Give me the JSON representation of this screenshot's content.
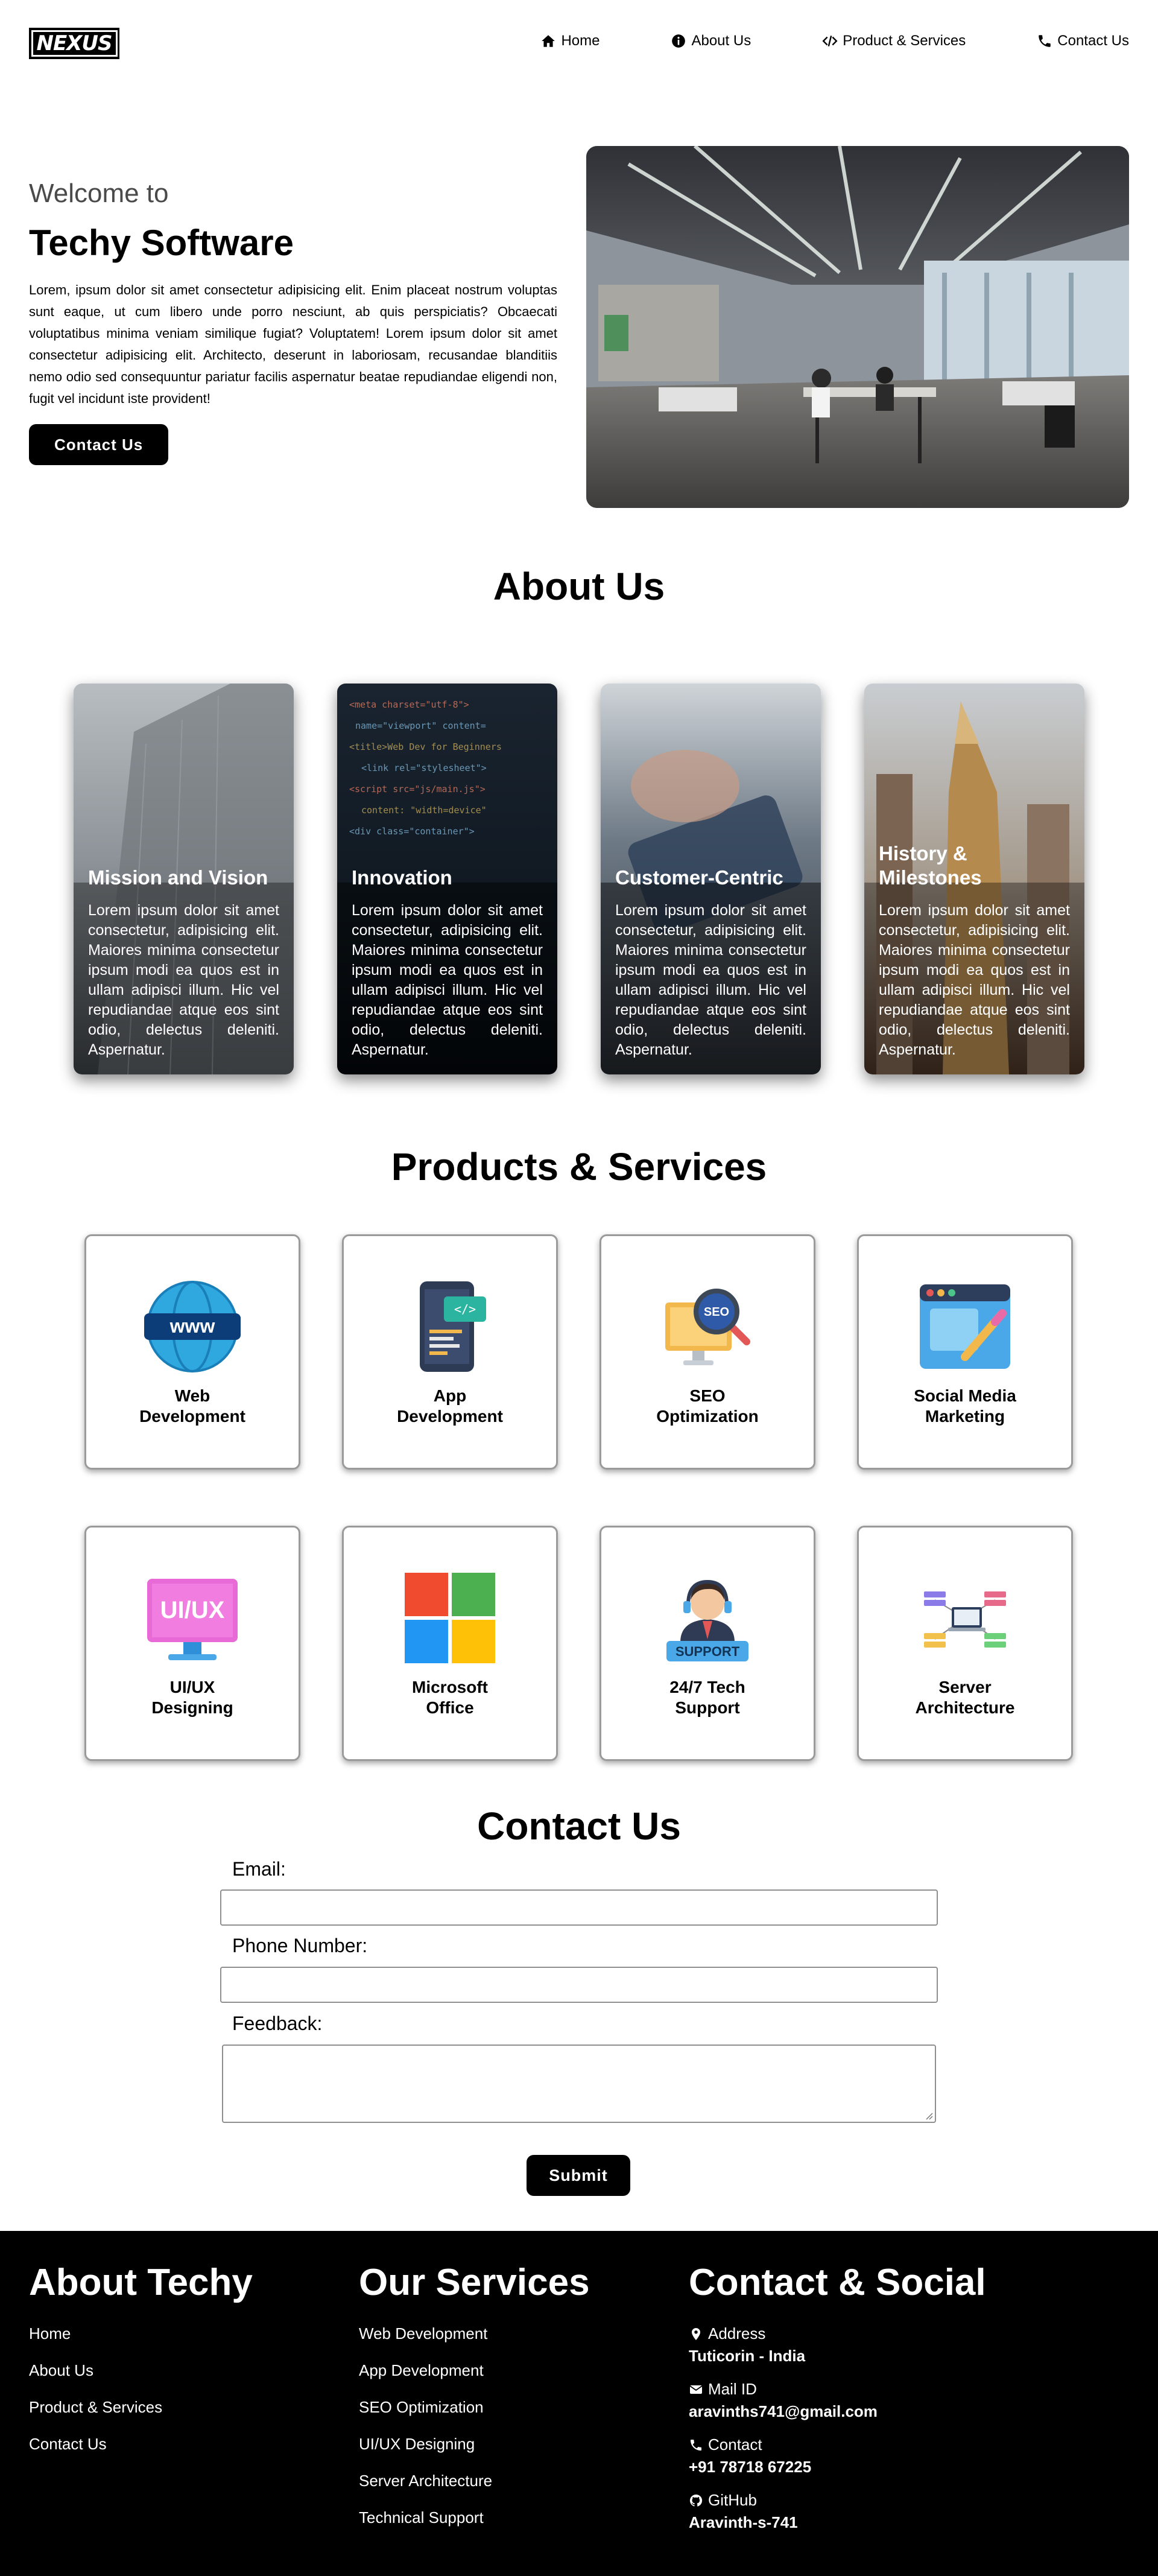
{
  "nav": {
    "logo": "NEXUS",
    "links": [
      {
        "label": "Home",
        "icon": "home-icon"
      },
      {
        "label": "About Us",
        "icon": "info-icon"
      },
      {
        "label": "Product & Services",
        "icon": "code-icon"
      },
      {
        "label": "Contact Us",
        "icon": "phone-icon"
      }
    ]
  },
  "hero": {
    "welcome": "Welcome to",
    "title": "Techy Software",
    "text": "Lorem, ipsum dolor sit amet consectetur adipisicing elit. Enim placeat nostrum voluptas sunt eaque, ut cum libero unde porro nesciunt, ab quis perspiciatis? Obcaecati voluptatibus minima veniam similique fugiat? Voluptatem! Lorem ipsum dolor sit amet consectetur adipisicing elit. Architecto, deserunt in laboriosam, recusandae blanditiis nemo odio sed consequuntur pariatur facilis aspernatur beatae repudiandae eligendi non, fugit vel incidunt iste provident!",
    "button": "Contact Us"
  },
  "about": {
    "title": "About Us",
    "cards": [
      {
        "title": "Mission and Vision",
        "text": "Lorem ipsum dolor sit amet consectetur, adipisicing elit. Maiores minima consectetur ipsum modi ea quos est in ullam adipisci illum. Hic vel repudiandae atque eos sint odio, delectus deleniti. Aspernatur."
      },
      {
        "title": "Innovation",
        "text": "Lorem ipsum dolor sit amet consectetur, adipisicing elit. Maiores minima consectetur ipsum modi ea quos est in ullam adipisci illum. Hic vel repudiandae atque eos sint odio, delectus deleniti. Aspernatur."
      },
      {
        "title": "Customer-Centric",
        "text": "Lorem ipsum dolor sit amet consectetur, adipisicing elit. Maiores minima consectetur ipsum modi ea quos est in ullam adipisci illum. Hic vel repudiandae atque eos sint odio, delectus deleniti. Aspernatur."
      },
      {
        "title": "History & Milestones",
        "text": "Lorem ipsum dolor sit amet consectetur, adipisicing elit. Maiores minima consectetur ipsum modi ea quos est in ullam adipisci illum. Hic vel repudiandae atque eos sint odio, delectus deleniti. Aspernatur."
      }
    ]
  },
  "products": {
    "title": "Products & Services",
    "items": [
      {
        "label": "Web Development",
        "icon": "www-globe-icon"
      },
      {
        "label": "App Development",
        "icon": "mobile-app-icon"
      },
      {
        "label": "SEO Optimization",
        "icon": "seo-magnifier-icon"
      },
      {
        "label": "Social Media Marketing",
        "icon": "social-media-icon"
      },
      {
        "label": "UI/UX Designing",
        "icon": "ui-ux-monitor-icon"
      },
      {
        "label": "Microsoft Office",
        "icon": "microsoft-logo-icon"
      },
      {
        "label": "24/7 Tech Support",
        "icon": "support-agent-icon"
      },
      {
        "label": "Server Architecture",
        "icon": "server-network-icon"
      }
    ]
  },
  "contact": {
    "title": "Contact Us",
    "email_label": "Email:",
    "phone_label": "Phone Number:",
    "feedback_label": "Feedback:",
    "submit": "Submit"
  },
  "footer": {
    "about_title": "About Techy",
    "about_links": [
      "Home",
      "About Us",
      "Product & Services",
      "Contact Us"
    ],
    "services_title": "Our Services",
    "services_links": [
      "Web Development",
      "App Development",
      "SEO Optimization",
      "UI/UX Designing",
      "Server Architecture",
      "Technical Support"
    ],
    "contact_title": "Contact & Social",
    "address_label": "Address",
    "address_value": "Tuticorin - India",
    "mail_label": "Mail ID",
    "mail_value": "aravinths741@gmail.com",
    "phone_label": "Contact",
    "phone_value": "+91 78718 67225",
    "github_label": "GitHub",
    "github_value": "Aravinth-s-741"
  },
  "colors": {
    "primary": "#000000",
    "background": "#ffffff"
  }
}
